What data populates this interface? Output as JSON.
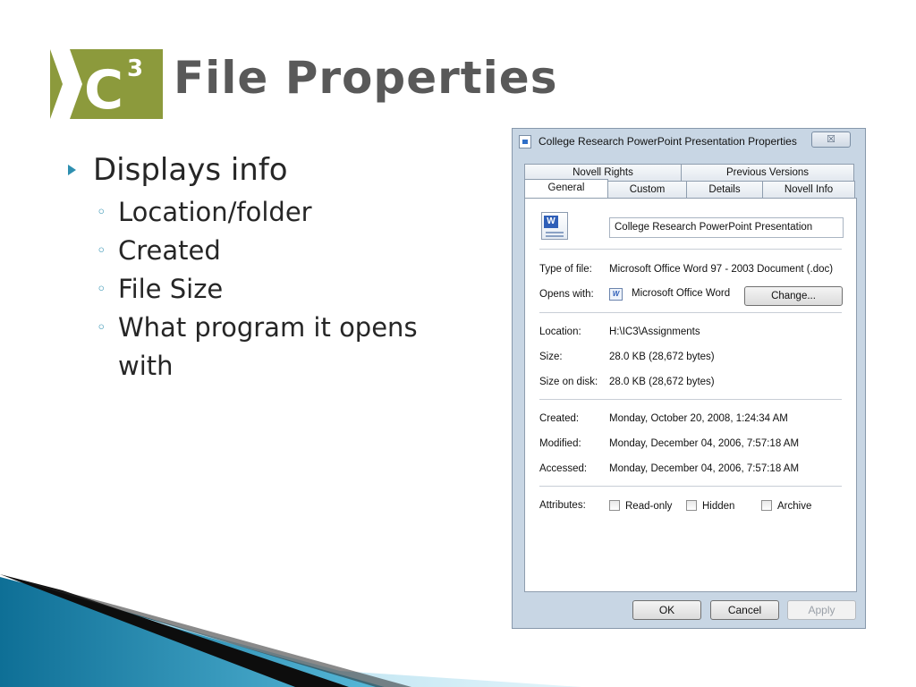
{
  "slide": {
    "logo_text": "IC",
    "logo_superscript": "3",
    "title": "File Properties",
    "bullet": "Displays info",
    "sub_bullets": [
      "Location/folder",
      "Created",
      "File Size",
      "What program it opens with"
    ]
  },
  "dialog": {
    "title": "College Research PowerPoint Presentation Properties",
    "close_glyph": "☒",
    "tabs_back": [
      "Novell Rights",
      "Previous Versions"
    ],
    "tabs_front": [
      "General",
      "Custom",
      "Details",
      "Novell Info"
    ],
    "active_tab": "General",
    "file_name": "College Research PowerPoint Presentation",
    "type_label": "Type of file:",
    "type_value": "Microsoft Office Word 97 - 2003 Document (.doc)",
    "opens_label": "Opens with:",
    "opens_value": "Microsoft Office Word",
    "change_label": "Change...",
    "location_label": "Location:",
    "location_value": "H:\\IC3\\Assignments",
    "size_label": "Size:",
    "size_value": "28.0 KB (28,672 bytes)",
    "size_disk_label": "Size on disk:",
    "size_disk_value": "28.0 KB (28,672 bytes)",
    "created_label": "Created:",
    "created_value": "Monday, October 20, 2008, 1:24:34 AM",
    "modified_label": "Modified:",
    "modified_value": "Monday, December 04, 2006, 7:57:18 AM",
    "accessed_label": "Accessed:",
    "accessed_value": "Monday, December 04, 2006, 7:57:18 AM",
    "attributes_label": "Attributes:",
    "attr_readonly": "Read-only",
    "attr_hidden": "Hidden",
    "attr_archive": "Archive",
    "ok_label": "OK",
    "cancel_label": "Cancel",
    "apply_label": "Apply"
  },
  "colors": {
    "logo_green": "#8c9a3c",
    "title_gray": "#595959",
    "bullet_blue": "#2e8fb0",
    "dialog_frame": "#c8d6e4"
  }
}
